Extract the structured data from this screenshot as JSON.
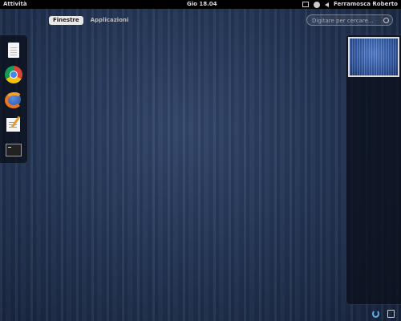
{
  "topbar": {
    "activities_label": "Attività",
    "clock": "Gio 18.04",
    "user_name": "Ferramosca Roberto",
    "tray_icons": [
      "network-icon",
      "accessibility-icon",
      "volume-icon"
    ]
  },
  "overview": {
    "tabs": [
      {
        "label": "Finestre",
        "active": true
      },
      {
        "label": "Applicazioni",
        "active": false
      }
    ],
    "search": {
      "placeholder": "Digitare per cercare...",
      "value": ""
    }
  },
  "dash": {
    "items": [
      {
        "icon": "files-icon"
      },
      {
        "icon": "chrome-icon"
      },
      {
        "icon": "firefox-icon"
      },
      {
        "icon": "text-editor-icon"
      },
      {
        "icon": "terminal-icon"
      }
    ]
  },
  "workspaces": {
    "count": 1,
    "active_index": 0
  },
  "bottom_tray": {
    "icons": [
      "update-icon",
      "removable-device-icon"
    ]
  },
  "colors": {
    "topbar": "#000000",
    "desktop": "#243656",
    "active_tab": "#e8e8e8"
  }
}
